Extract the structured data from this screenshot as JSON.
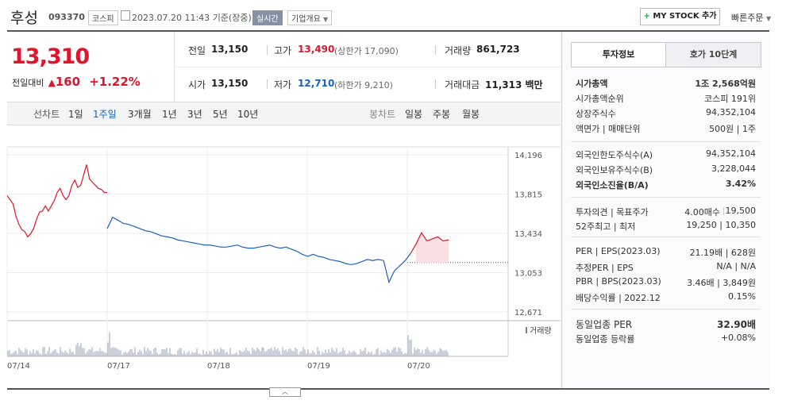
{
  "header": {
    "name": "후성",
    "code": "093370",
    "market": "코스피",
    "datetime": "2023.07.20 11:43",
    "basis": "기준(장중)",
    "realtime": "실시간",
    "company_info": "기업개요",
    "mystock": "MY STOCK 추가",
    "quick_order": "빠른주문"
  },
  "price": {
    "current": "13,310",
    "change_label": "전일대비",
    "change": "160",
    "change_pct": "+1.22%"
  },
  "summary": {
    "prev_label": "전일",
    "prev": "13,150",
    "high_label": "고가",
    "high": "13,490",
    "upper_limit": "(상한가 17,090)",
    "volume_label": "거래량",
    "volume": "861,723",
    "open_label": "시가",
    "open": "13,150",
    "low_label": "저가",
    "low": "12,710",
    "lower_limit": "(하한가 9,210)",
    "amount_label": "거래대금",
    "amount": "11,313 백만"
  },
  "tabs": {
    "line_label": "선차트",
    "line_items": [
      "1일",
      "1주일",
      "3개월",
      "1년",
      "3년",
      "5년",
      "10년"
    ],
    "candle_label": "봉차트",
    "candle_items": [
      "일봉",
      "주봉",
      "월봉"
    ]
  },
  "chart_data": {
    "type": "line",
    "y_ticks": [
      "14,196",
      "13,815",
      "13,434",
      "13,053",
      "12,671"
    ],
    "x_ticks": [
      "07/14",
      "07/17",
      "07/18",
      "07/19",
      "07/20"
    ],
    "prev_close": 13150,
    "volume_legend": "거래량",
    "series": [
      {
        "values": [
          13800,
          13760,
          13720,
          13600,
          13520,
          13470,
          13450,
          13400,
          13430,
          13480,
          13570,
          13640,
          13650,
          13700,
          13650,
          13700,
          13750,
          13830,
          13870,
          13800,
          13760,
          13800,
          13900,
          13950,
          13880,
          13900,
          14000,
          14100,
          13960,
          13930,
          13900,
          13870,
          13860,
          13830,
          13830
        ]
      },
      {
        "values": [
          13480,
          13590,
          13560,
          13530,
          13520,
          13500,
          13480,
          13460,
          13450,
          13430,
          13410,
          13400,
          13390,
          13370,
          13360,
          13350,
          13340,
          13330,
          13320,
          13320,
          13310,
          13300,
          13300,
          13310,
          13320,
          13300,
          13290,
          13290,
          13300,
          13310,
          13320,
          13300,
          13290,
          13300,
          13280,
          13260,
          13230,
          13210,
          13230,
          13210,
          13200,
          13180,
          13170,
          13160,
          13140,
          13130,
          13140,
          13160,
          13180,
          13170,
          13180,
          13170,
          12960,
          13070,
          13120,
          13170,
          13240,
          13330,
          13440,
          13360,
          13380,
          13400,
          13360,
          13370
        ]
      }
    ]
  },
  "right": {
    "tab_invest": "투자정보",
    "tab_hoga": "호가 10단계",
    "rows1": [
      {
        "label": "시가총액",
        "value": "1조 2,568억원"
      },
      {
        "label": "시가총액순위",
        "value": "코스피 191위"
      },
      {
        "label": "상장주식수",
        "value": "94,352,104"
      },
      {
        "label": "액면가 | 매매단위",
        "value": "500원 | 1주"
      }
    ],
    "rows2": [
      {
        "label": "외국인한도주식수(A)",
        "value": "94,352,104"
      },
      {
        "label": "외국인보유주식수(B)",
        "value": "3,228,044"
      },
      {
        "label": "외국인소진율(B/A)",
        "value": "3.42%"
      }
    ],
    "opinion_label": "투자의견 | 목표주가",
    "opinion_value": "4.00매수",
    "target_price": "19,500",
    "w52_label": "52주최고 | 최저",
    "w52_value": "19,250 | 10,350",
    "per_label": "PER | EPS(2023.03)",
    "per_value": "21.19배 | 628원",
    "est_label": "추정PER | EPS",
    "est_value": "N/A | N/A",
    "pbr_label": "PBR | BPS(2023.03)",
    "pbr_value": "3.46배 | 3,849원",
    "div_label": "배당수익률 | 2022.12",
    "div_value": "0.15%",
    "sector_per_label": "동일업종 PER",
    "sector_per_value": "32.90배",
    "sector_rate_label": "동일업종 등락률",
    "sector_rate_value": "+0.08%"
  },
  "colors": {
    "up": "#e0142b",
    "down": "#1a5fc2"
  }
}
